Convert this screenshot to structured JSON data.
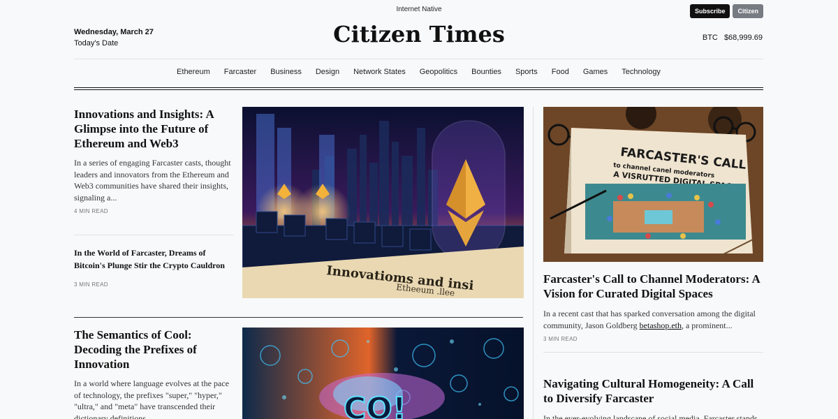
{
  "header": {
    "tagline": "Internet Native",
    "subscribe_label": "Subscribe",
    "citizen_label": "Citizen",
    "date": "Wednesday, March 27",
    "date_caption": "Today's Date",
    "masthead": "Citizen Times",
    "btc_label": "BTC",
    "btc_price": "$68,999.69"
  },
  "nav": [
    "Ethereum",
    "Farcaster",
    "Business",
    "Design",
    "Network States",
    "Geopolitics",
    "Bounties",
    "Sports",
    "Food",
    "Games",
    "Technology"
  ],
  "articles": {
    "a1": {
      "title": "Innovations and Insights: A Glimpse into the Future of Ethereum and Web3",
      "excerpt": "In a series of engaging Farcaster casts, thought leaders and innovators from the Ethereum and Web3 communities have shared their insights, signaling a...",
      "read": "4 MIN READ",
      "image_text_1": "Innovatioms and insi",
      "image_text_2": "Etheeum .llee"
    },
    "a2": {
      "title": "In the World of Farcaster, Dreams of Bitcoin's Plunge Stir the Crypto Cauldron",
      "read": "3 MIN READ"
    },
    "a3": {
      "title": "The Semantics of Cool: Decoding the Prefixes of Innovation",
      "excerpt": "In a world where language evolves at the pace of technology, the prefixes \"super,\" \"hyper,\" \"ultra,\" and \"meta\" have transcended their dictionary definitions...",
      "image_text": "CO!"
    },
    "a4": {
      "title": "Farcaster's Call to Channel Moderators: A Vision for Curated Digital Spaces",
      "excerpt_before": "In a recent cast that has sparked conversation among the digital community, Jason Goldberg ",
      "excerpt_link": "betashop.eth",
      "excerpt_after": ", a prominent...",
      "read": "3 MIN READ",
      "image_line_1": "FARCASTER'S CALL",
      "image_line_2": "to channel canel moderators",
      "image_line_3": "A VISRUTTED DIGITAL SPACES"
    },
    "a5": {
      "title": "Navigating Cultural Homogeneity: A Call to Diversify Farcaster",
      "excerpt": "In the ever-evolving landscape of social media, Farcaster stands..."
    }
  },
  "colors": {
    "accent_dark": "#111111",
    "button_gray": "#777b82",
    "background": "#f8f9fb"
  }
}
